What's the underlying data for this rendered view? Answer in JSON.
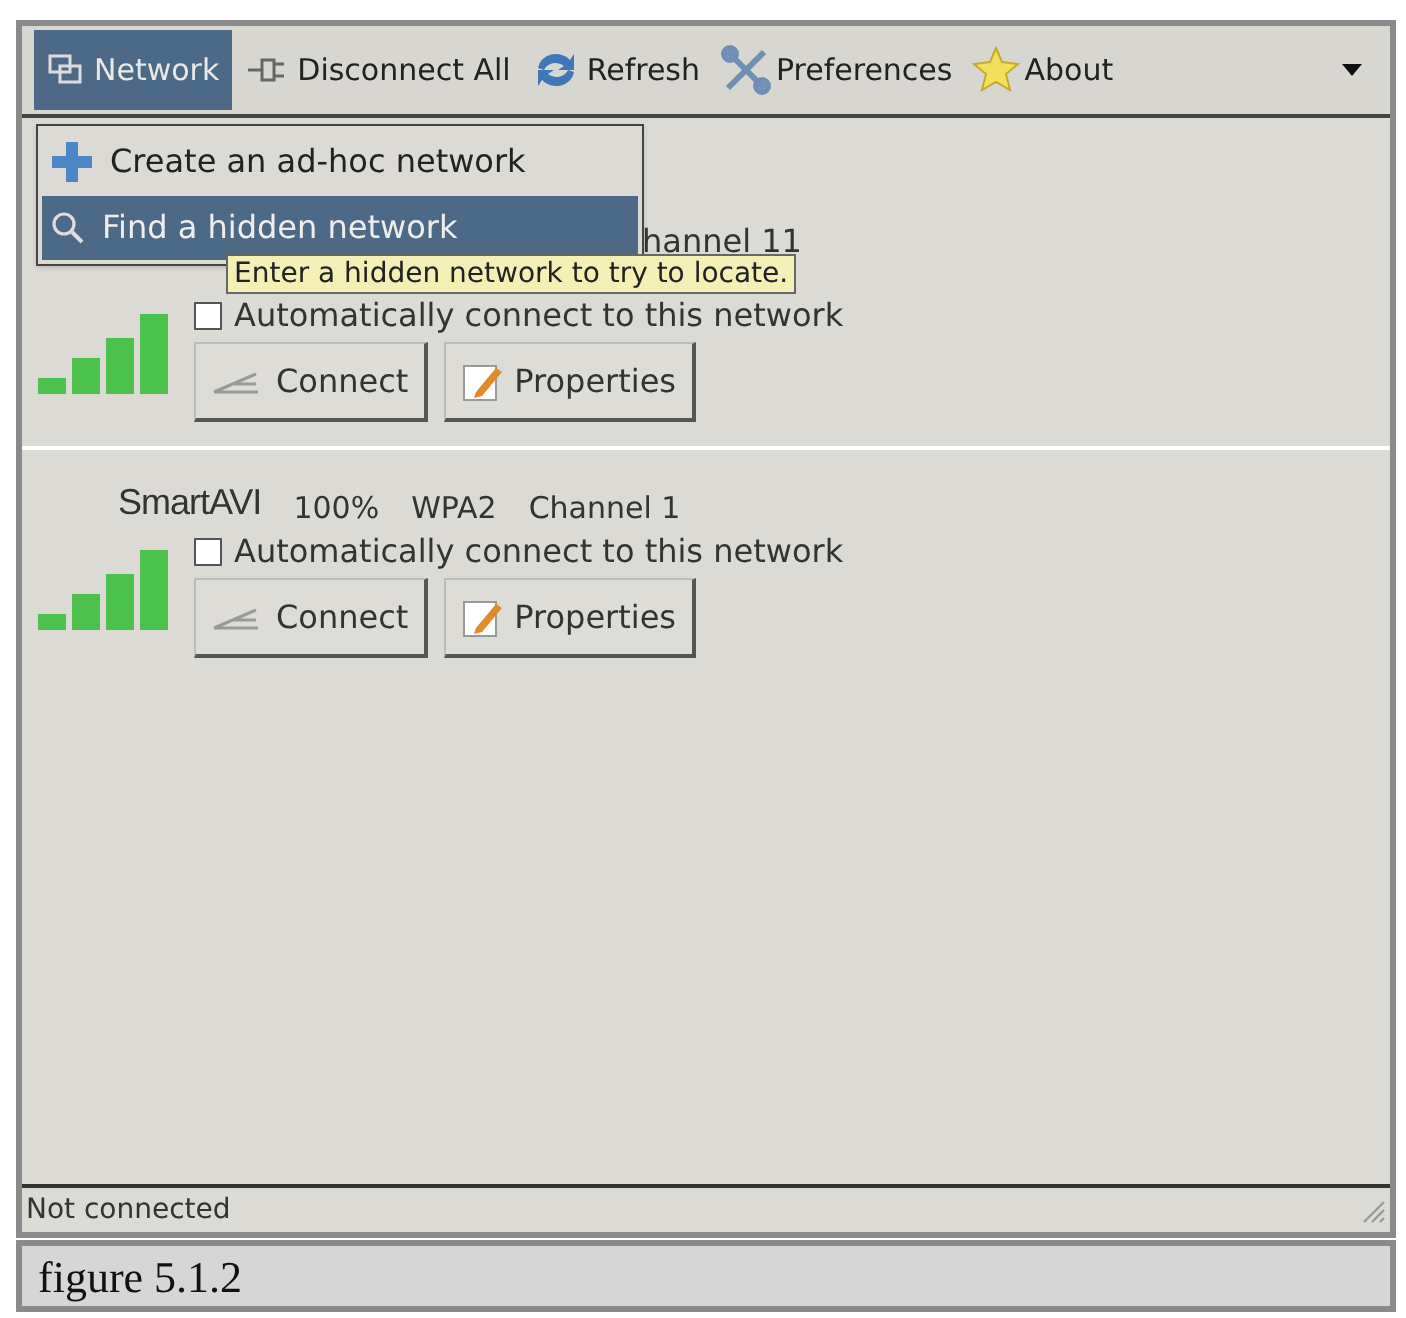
{
  "toolbar": [
    {
      "label": "Network",
      "selected": true
    },
    {
      "label": "Disconnect All",
      "selected": false
    },
    {
      "label": "Refresh",
      "selected": false
    },
    {
      "label": "Preferences",
      "selected": false
    },
    {
      "label": "About",
      "selected": false
    }
  ],
  "menu": [
    {
      "label": "Create an ad-hoc network",
      "selected": false
    },
    {
      "label": "Find a hidden network",
      "selected": true
    }
  ],
  "tooltip": "Enter a hidden network to try to locate.",
  "networks": [
    {
      "kind": "covered",
      "info": "hannel 11",
      "auto_connect_label": "Automatically connect to this network",
      "auto_connect": false,
      "buttons": [
        "Connect",
        "Properties"
      ]
    },
    {
      "kind": "full",
      "name": "SmartAVI",
      "strength": "100%",
      "encryption": "WPA2",
      "channel": "Channel 1",
      "auto_connect_label": "Automatically connect to this network",
      "auto_connect": false,
      "buttons": [
        "Connect",
        "Properties"
      ]
    }
  ],
  "status_bar": "Not connected",
  "caption": "figure 5.1.2"
}
